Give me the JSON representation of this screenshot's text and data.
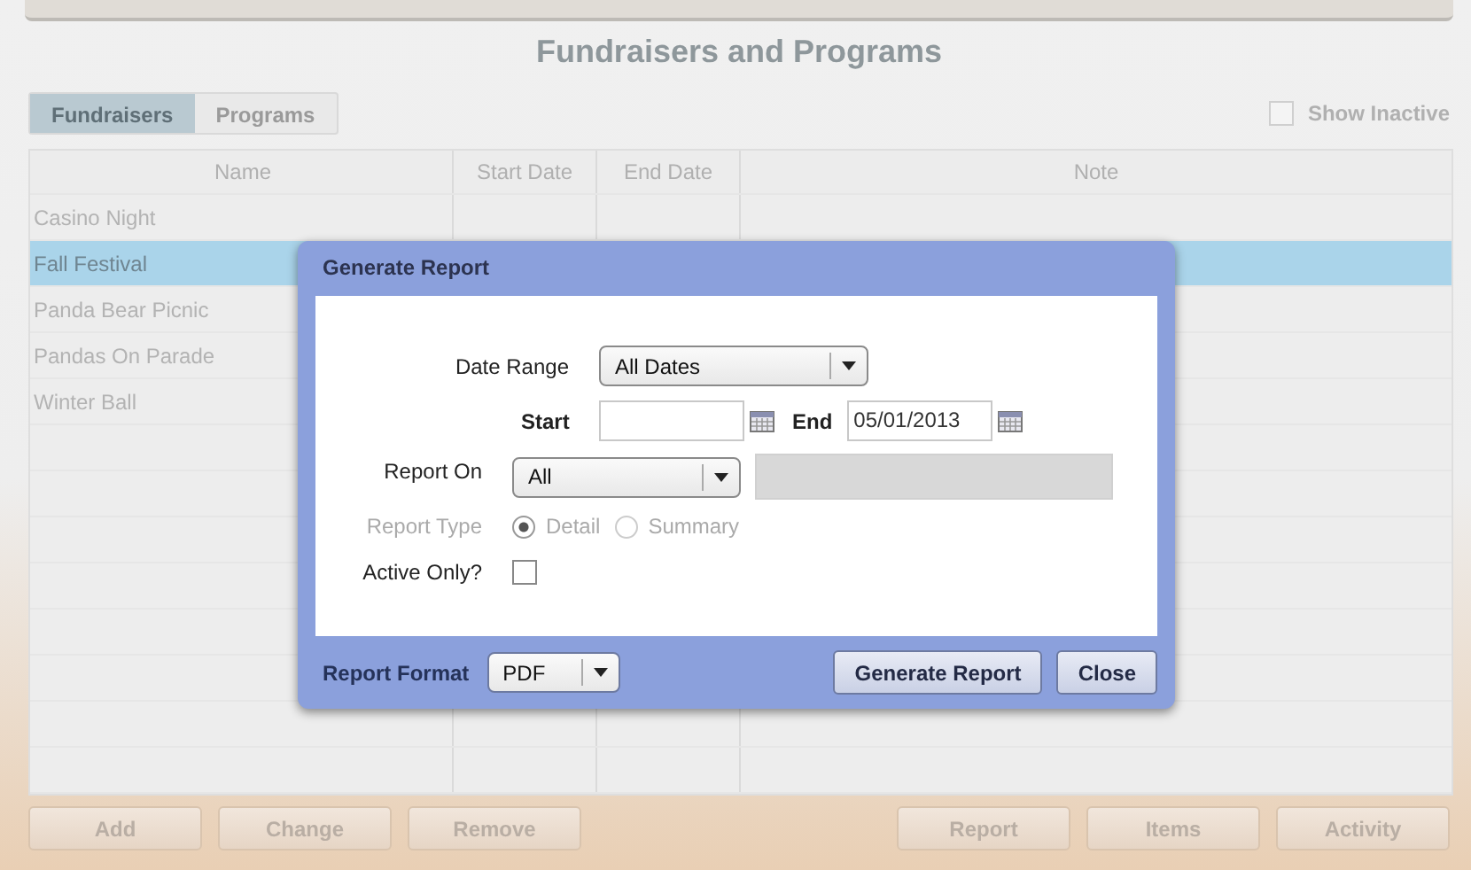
{
  "title": "Fundraisers and Programs",
  "tabs": [
    {
      "label": "Fundraisers",
      "selected": true
    },
    {
      "label": "Programs",
      "selected": false
    }
  ],
  "show_inactive": {
    "label": "Show Inactive",
    "checked": false
  },
  "table": {
    "columns": [
      "Name",
      "Start Date",
      "End Date",
      "Note"
    ],
    "rows": [
      {
        "name": "Casino Night",
        "selected": false
      },
      {
        "name": "Fall Festival",
        "selected": true
      },
      {
        "name": "Panda Bear Picnic",
        "selected": false
      },
      {
        "name": "Pandas On Parade",
        "selected": false
      },
      {
        "name": "Winter Ball",
        "selected": false
      }
    ]
  },
  "buttons_left": [
    "Add",
    "Change",
    "Remove"
  ],
  "buttons_right": [
    "Report",
    "Items",
    "Activity"
  ],
  "dialog": {
    "title": "Generate Report",
    "date_range": {
      "label": "Date Range",
      "value": "All Dates"
    },
    "start": {
      "label": "Start"
    },
    "end": {
      "label": "End",
      "value": "05/01/2013"
    },
    "report_on": {
      "label": "Report On",
      "value": "All"
    },
    "report_type": {
      "label": "Report Type",
      "disabled": true,
      "options": [
        {
          "label": "Detail",
          "selected": true
        },
        {
          "label": "Summary",
          "selected": false
        }
      ]
    },
    "active_only": {
      "label": "Active Only?",
      "checked": false
    },
    "report_format": {
      "label": "Report Format",
      "value": "PDF"
    },
    "buttons": [
      "Generate Report",
      "Close"
    ]
  }
}
